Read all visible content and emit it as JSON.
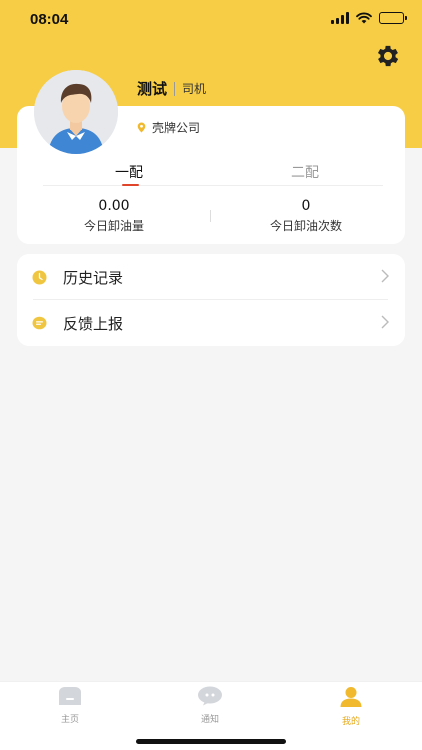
{
  "status_bar": {
    "time": "08:04"
  },
  "profile": {
    "name": "测试",
    "role": "司机",
    "company": "壳牌公司"
  },
  "tabs": [
    {
      "label": "一配",
      "active": true
    },
    {
      "label": "二配",
      "active": false
    }
  ],
  "stats": [
    {
      "value": "0.00",
      "label": "今日卸油量"
    },
    {
      "value": "0",
      "label": "今日卸油次数"
    }
  ],
  "menu": [
    {
      "label": "历史记录",
      "icon": "clock-icon"
    },
    {
      "label": "反馈上报",
      "icon": "feedback-icon"
    }
  ],
  "tabbar": [
    {
      "label": "主页",
      "icon": "home-icon",
      "active": false
    },
    {
      "label": "通知",
      "icon": "chat-icon",
      "active": false
    },
    {
      "label": "我的",
      "icon": "person-icon",
      "active": true
    }
  ],
  "colors": {
    "header": "#f6cd45",
    "accent": "#e6a91c",
    "tab_underline": "#e0452b",
    "background": "#f5f5f5"
  }
}
